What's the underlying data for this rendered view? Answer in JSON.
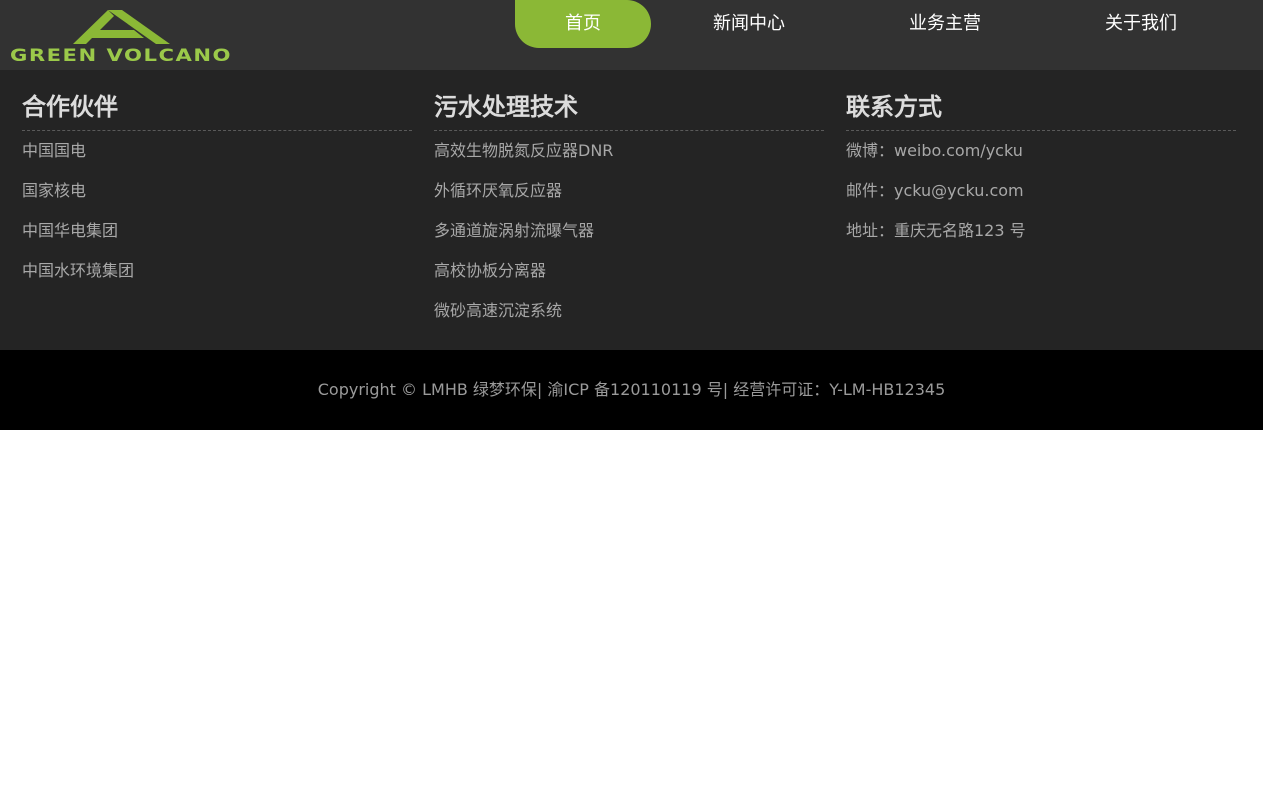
{
  "header": {
    "logo_text": "GREEN VOLCANO",
    "nav": [
      {
        "label": "首页",
        "active": true
      },
      {
        "label": "新闻中心",
        "active": false
      },
      {
        "label": "业务主营",
        "active": false
      },
      {
        "label": "关于我们",
        "active": false
      }
    ]
  },
  "footer": {
    "columns": [
      {
        "title": "合作伙伴",
        "items": [
          "中国国电",
          "国家核电",
          "中国华电集团",
          "中国水环境集团"
        ]
      },
      {
        "title": "污水处理技术",
        "items": [
          "高效生物脱氮反应器DNR",
          "外循环厌氧反应器",
          "多通道旋涡射流曝气器",
          "高校协板分离器",
          "微砂高速沉淀系统"
        ]
      },
      {
        "title": "联系方式",
        "items": [
          "微博：weibo.com/ycku",
          "邮件：ycku@ycku.com",
          "地址：重庆无名路123 号"
        ]
      }
    ],
    "copyright": "Copyright © LMHB 绿梦环保| 渝ICP 备120110119 号| 经营许可证：Y-LM-HB12345"
  },
  "colors": {
    "accent": "#8bb836",
    "header_bg": "#323232",
    "footer_bg": "#242424",
    "copyright_bg": "#000000"
  }
}
